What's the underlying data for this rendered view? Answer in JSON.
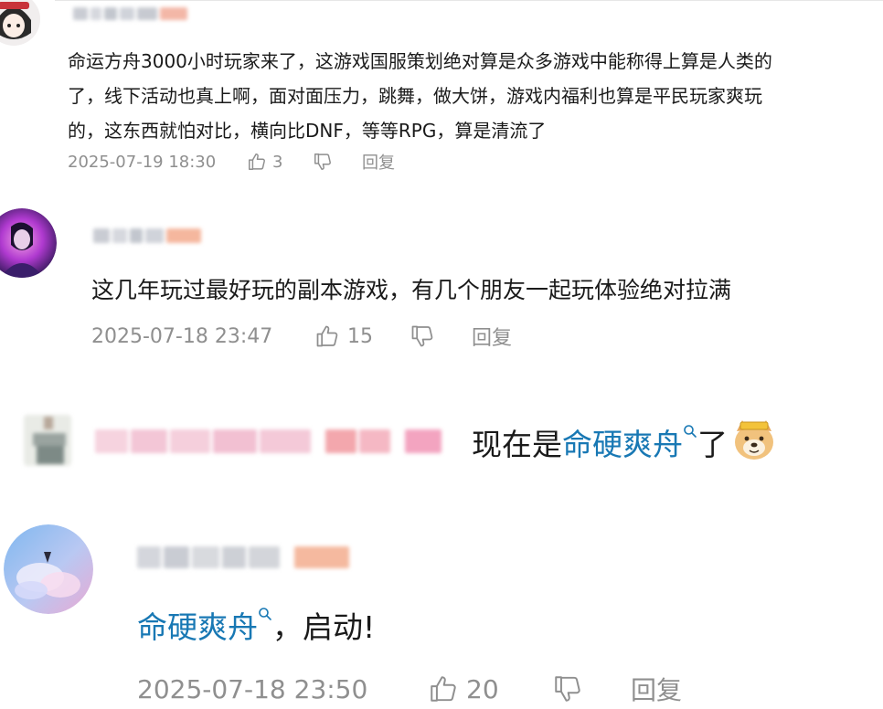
{
  "comments": [
    {
      "text_lines": [
        "命运方舟3000小时玩家来了，这游戏国服策划绝对算是众多游戏中能称得上算是人类的",
        "了，线下活动也真上啊，面对面压力，跳舞，做大饼，游戏内福利也算是平民玩家爽玩",
        "的，这东西就怕对比，横向比DNF，等等RPG，算是清流了"
      ],
      "date": "2025-07-19 18:30",
      "likes": "3",
      "reply": "回复"
    },
    {
      "text": "这几年玩过最好玩的副本游戏，有几个朋友一起玩体验绝对拉满",
      "date": "2025-07-18 23:47",
      "likes": "15",
      "reply": "回复"
    },
    {
      "prefix": "现在是",
      "link": "命硬爽舟",
      "suffix": "了"
    },
    {
      "link": "命硬爽舟",
      "suffix": "，启动!",
      "date": "2025-07-18 23:50",
      "likes": "20",
      "reply": "回复"
    }
  ],
  "colors": {
    "link": "#1878b4",
    "meta": "#8f8f8f",
    "text": "#1a1a1a"
  },
  "icons": [
    "thumbs-up-icon",
    "thumbs-down-icon",
    "search-icon",
    "doge-emoji"
  ]
}
